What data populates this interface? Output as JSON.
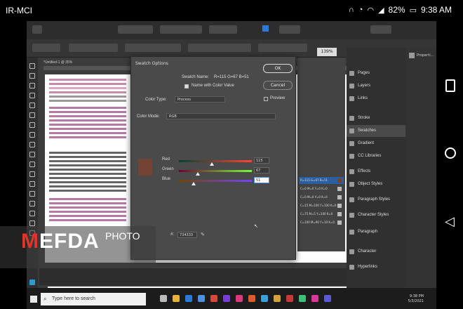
{
  "phone_status": {
    "carrier": "IR-MCI",
    "battery": "82%",
    "time": "9:38 AM"
  },
  "document": {
    "tab_title": "*Untitled-1 @ 35%"
  },
  "toolbar": {
    "zoom": "139%"
  },
  "dialog": {
    "title": "Swatch Options",
    "swatch_name_label": "Swatch Name:",
    "swatch_name_value": "R=115 G=67 B=51",
    "name_with_color_value_label": "Name with Color Value",
    "color_type_label": "Color Type:",
    "color_type_value": "Process",
    "color_mode_label": "Color Mode:",
    "color_mode_value": "RGB",
    "ok_label": "OK",
    "cancel_label": "Cancel",
    "preview_label": "Preview",
    "channels": [
      {
        "name": "Red",
        "value": "115",
        "level": 0.45
      },
      {
        "name": "Green",
        "value": "67",
        "level": 0.26
      },
      {
        "name": "Blue",
        "value": "51",
        "level": 0.2
      }
    ],
    "hex_label": "#:",
    "hex_value": "734333",
    "swatch_color": "#734333"
  },
  "swatches_panel": {
    "rows": [
      {
        "label": "R=115 G=67 B=51",
        "selected": true
      },
      {
        "label": "C=0 M=0 Y=0 K=0",
        "selected": false
      },
      {
        "label": "C=0 M=0 Y=0 K=0",
        "selected": false
      },
      {
        "label": "C=15 M=100 Y=100 K=0",
        "selected": false
      },
      {
        "label": "C=75 M=5 Y=100 K=0",
        "selected": false
      },
      {
        "label": "C=100 M=90 Y=10 K=0",
        "selected": false
      }
    ]
  },
  "panels": [
    {
      "label": "Pages"
    },
    {
      "label": "Layers"
    },
    {
      "label": "Links"
    },
    {
      "label": "Stroke"
    },
    {
      "label": "Swatches"
    },
    {
      "label": "Gradient"
    },
    {
      "label": "CC Libraries"
    },
    {
      "label": "Effects"
    },
    {
      "label": "Object Styles"
    },
    {
      "label": "Paragraph Styles"
    },
    {
      "label": "Character Styles"
    },
    {
      "label": "Paragraph"
    },
    {
      "label": "Character"
    },
    {
      "label": "Hyperlinks"
    }
  ],
  "properties_panel": {
    "label": "Properti..."
  },
  "watermark": {
    "brand_first": "M",
    "brand_rest": "EFDA",
    "brand_suffix": "PHOTO"
  },
  "taskbar": {
    "search_placeholder": "Type here to search",
    "time": "9:38 PM",
    "date": "5/3/2021"
  },
  "colors": {
    "accent": "#2c5fa0",
    "watermark_red": "#e4332b"
  }
}
